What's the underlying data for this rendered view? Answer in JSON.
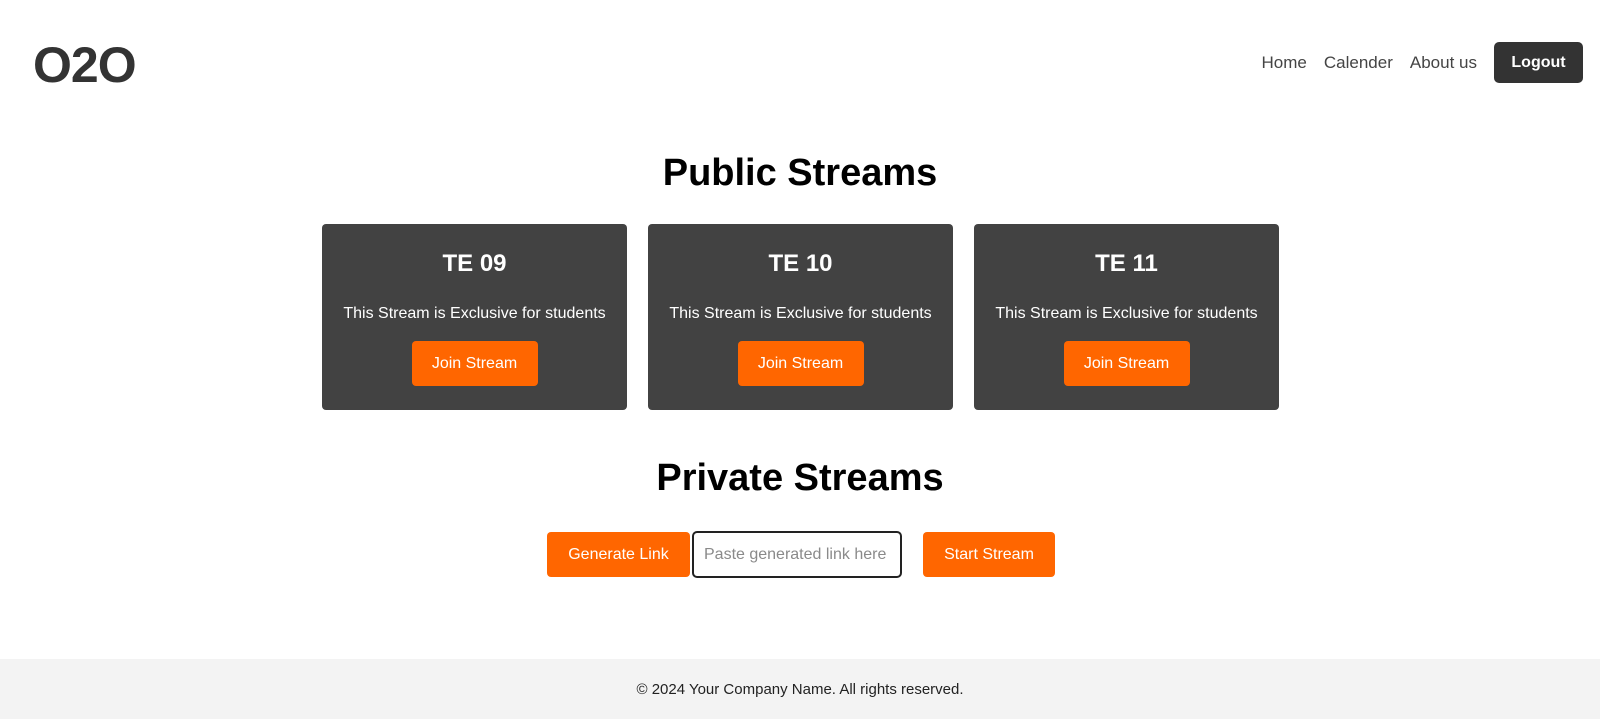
{
  "header": {
    "logo": "O2O",
    "nav": [
      {
        "label": "Home"
      },
      {
        "label": "Calender"
      },
      {
        "label": "About us"
      }
    ],
    "logout_label": "Logout"
  },
  "public_streams": {
    "title": "Public Streams",
    "cards": [
      {
        "title": "TE 09",
        "description": "This Stream is Exclusive for students",
        "button": "Join Stream"
      },
      {
        "title": "TE 10",
        "description": "This Stream is Exclusive for students",
        "button": "Join Stream"
      },
      {
        "title": "TE 11",
        "description": "This Stream is Exclusive for students",
        "button": "Join Stream"
      }
    ]
  },
  "private_streams": {
    "title": "Private Streams",
    "generate_label": "Generate Link",
    "link_placeholder": "Paste generated link here",
    "link_value": "",
    "start_label": "Start Stream"
  },
  "footer": {
    "text": "© 2024 Your Company Name. All rights reserved."
  },
  "colors": {
    "accent": "#ff6600",
    "card_bg": "#424242",
    "logout_bg": "#333333",
    "footer_bg": "#f3f3f3"
  }
}
